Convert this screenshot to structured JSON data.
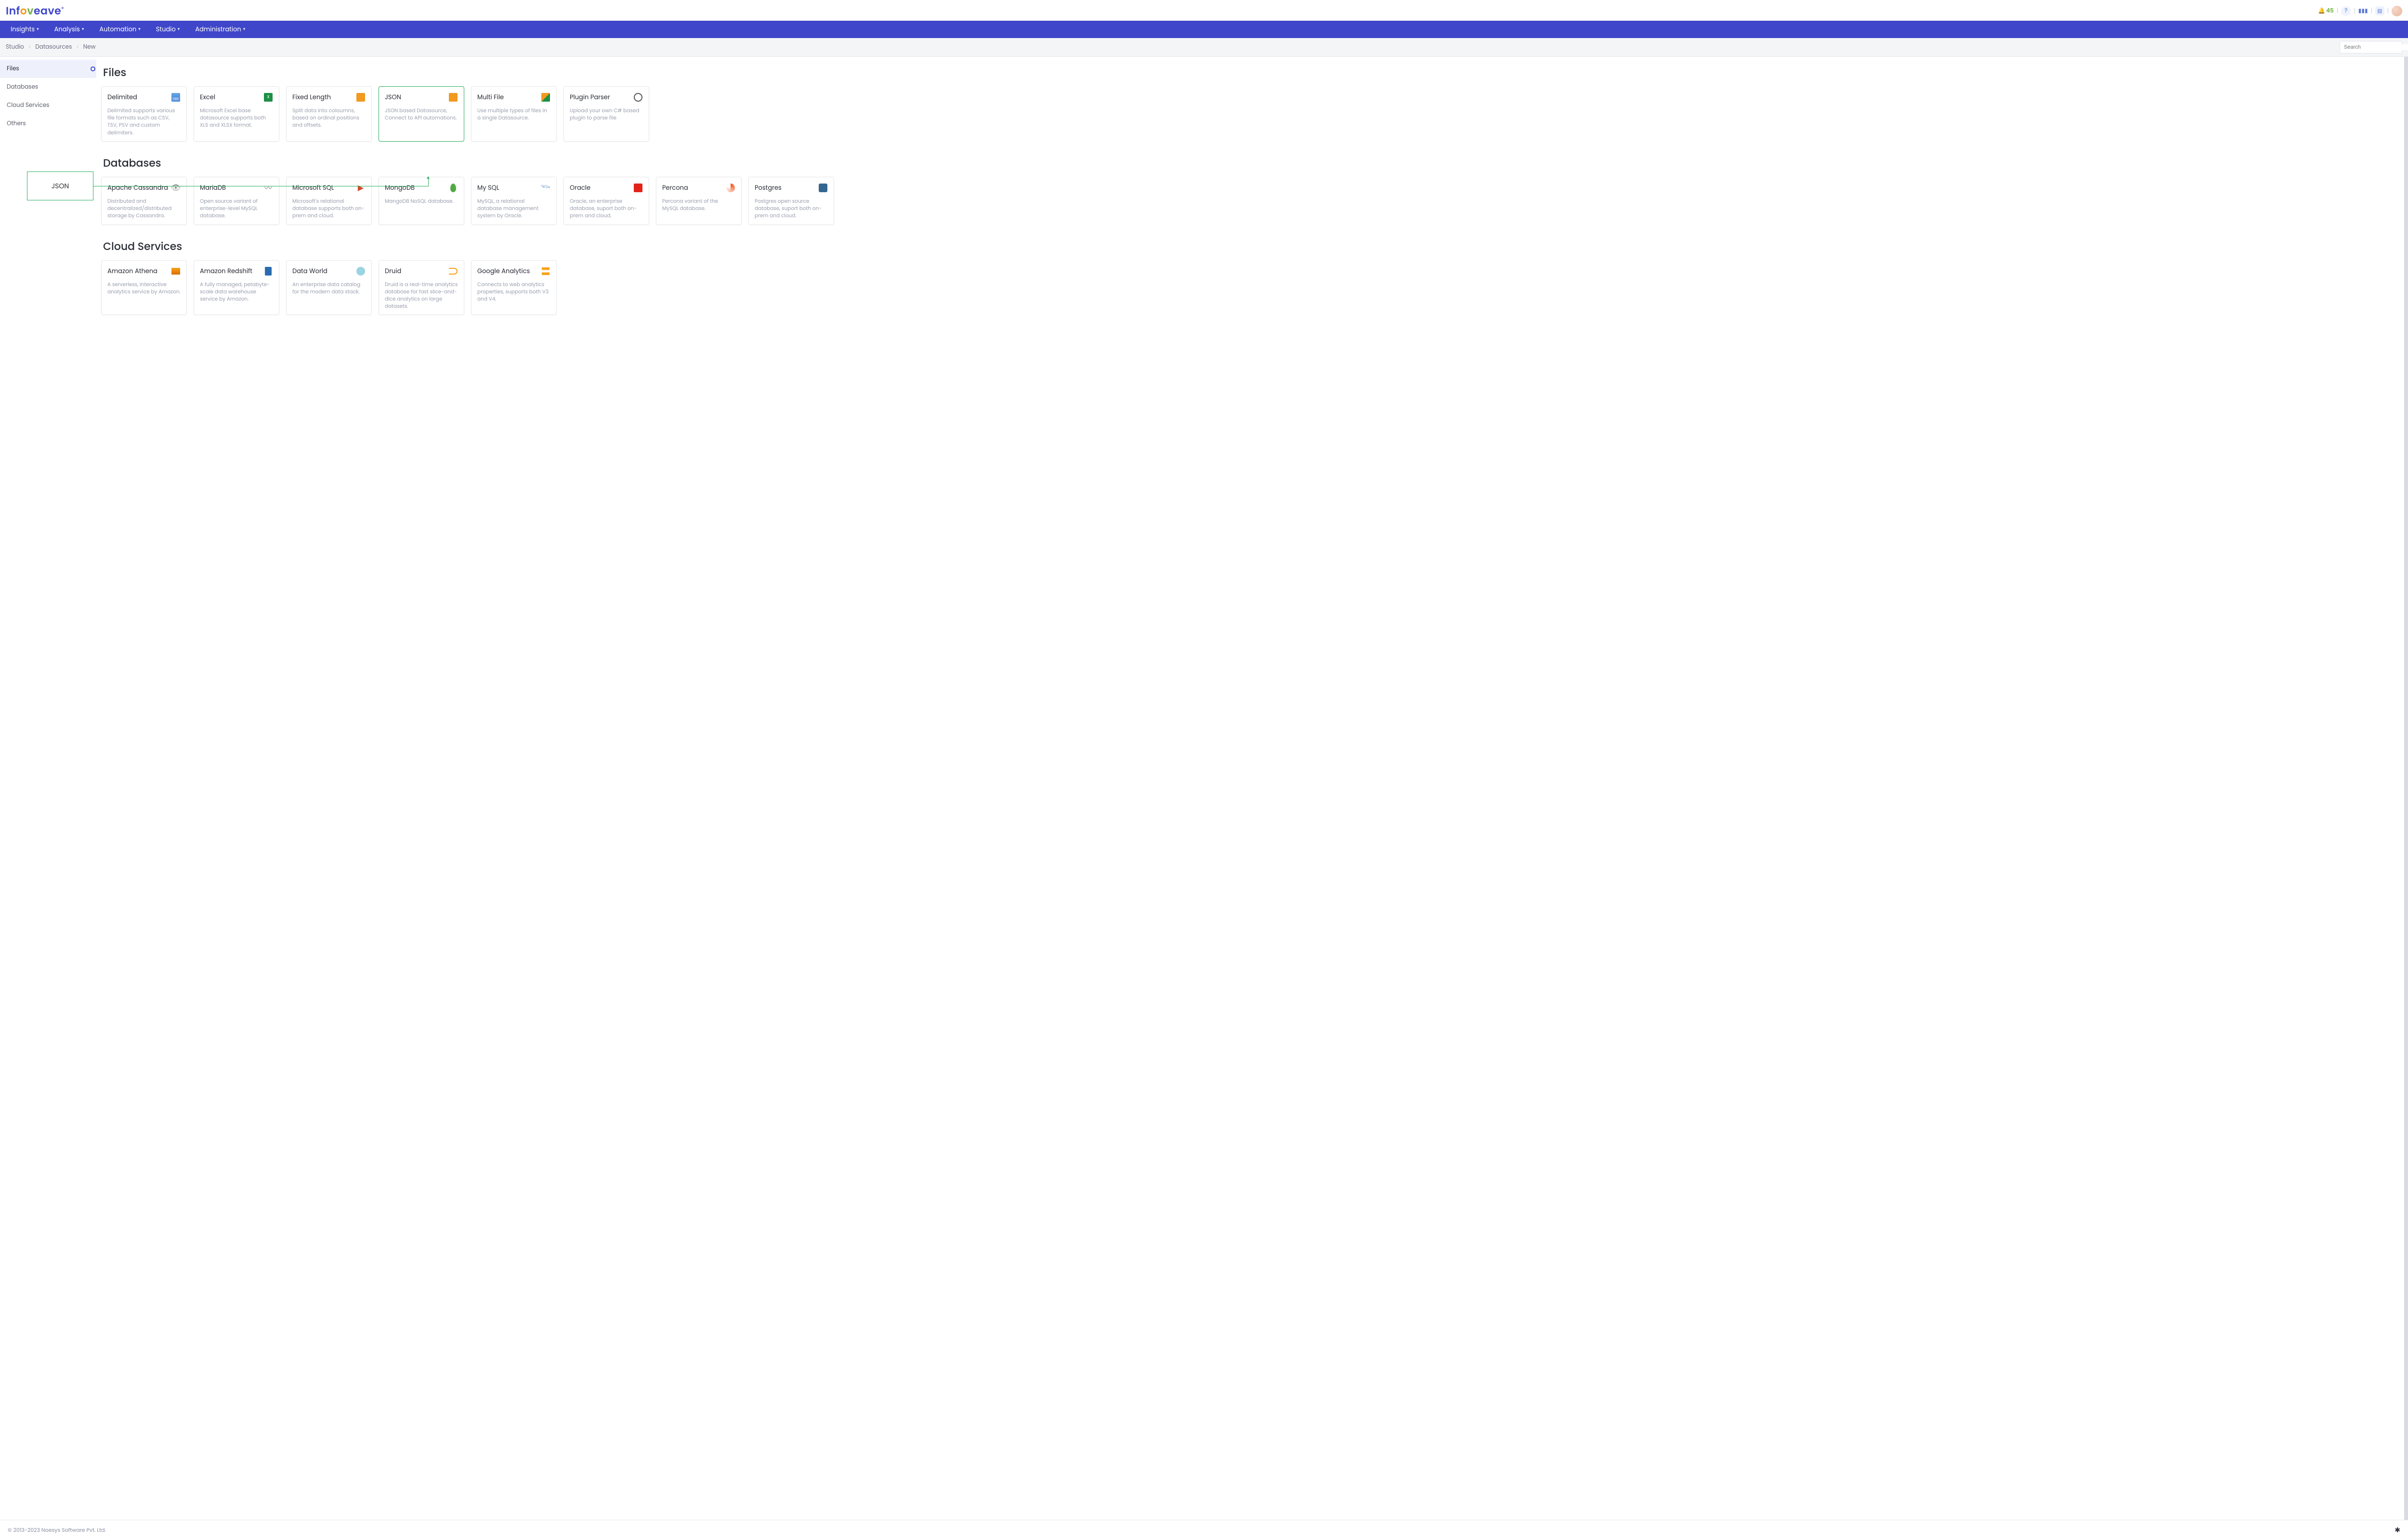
{
  "brand": {
    "part1": "Inf",
    "part2": "o",
    "part3": "v",
    "part4": "eave"
  },
  "notifications_count": "45",
  "nav": {
    "insights": "Insights",
    "analysis": "Analysis",
    "automation": "Automation",
    "studio": "Studio",
    "administration": "Administration"
  },
  "breadcrumbs": {
    "0": "Studio",
    "1": "Datasources",
    "2": "New"
  },
  "search_placeholder": "Search",
  "sidebar": {
    "files": "Files",
    "databases": "Databases",
    "cloud": "Cloud Services",
    "others": "Others"
  },
  "callout_label": "JSON",
  "sections": {
    "files": {
      "heading": "Files",
      "cards": {
        "delimited": {
          "title": "Delimited",
          "desc": "Delimited supports various file formats such as CSV, TSV, PSV and custom delimiters."
        },
        "excel": {
          "title": "Excel",
          "desc": "Microsoft Excel base datasource supports both XLS and XLSX format."
        },
        "fixed": {
          "title": "Fixed Length",
          "desc": "Split data into coloumns, based on ordinal positions and offsets."
        },
        "json": {
          "title": "JSON",
          "desc": "JSON based Datasource, Connect to API automations."
        },
        "multi": {
          "title": "Multi File",
          "desc": "Use multiple types of files in a single Datasource."
        },
        "plugin": {
          "title": "Plugin Parser",
          "desc": "Upload your own C# based plugin to parse file"
        }
      }
    },
    "databases": {
      "heading": "Databases",
      "cards": {
        "cassandra": {
          "title": "Apache Cassandra",
          "desc": "Distributed and decentralized/distributed storage by Cassandra."
        },
        "mariadb": {
          "title": "MariaDB",
          "desc": "Open source variant of enterprise-level MySQL database."
        },
        "mssql": {
          "title": "Microsoft SQL",
          "desc": "Microsoft's relational database supports both on-prem and cloud."
        },
        "mongo": {
          "title": "MongoDB",
          "desc": "MangoDB NoSQL database."
        },
        "mysql": {
          "title": "My SQL",
          "desc": "MySQL, a relational database management system by Oracle."
        },
        "oracle": {
          "title": "Oracle",
          "desc": "Oracle, an enterprise database, suport both on-prem and cloud."
        },
        "percona": {
          "title": "Percona",
          "desc": "Percona variant of the MySQL database."
        },
        "postgres": {
          "title": "Postgres",
          "desc": "Postgres open source database, suport both on-prem and cloud."
        }
      }
    },
    "cloud": {
      "heading": "Cloud Services",
      "cards": {
        "athena": {
          "title": "Amazon Athena",
          "desc": "A serverless, interactive analytics service by Amazon."
        },
        "redshift": {
          "title": "Amazon Redshift",
          "desc": "A fully managed, petabyte-scale data warehouse service by Amazon."
        },
        "dataworld": {
          "title": "Data World",
          "desc": "An enterprise data catalog for the modern data stack."
        },
        "druid": {
          "title": "Druid",
          "desc": "Druid is a real-time analytics database for fast slice-and-dice analytics on large datasets."
        },
        "ga": {
          "title": "Google Analytics",
          "desc": "Connects to web analytics properties, supports both V3 and V4."
        }
      }
    }
  },
  "footer_text": "© 2013-2023 Noesys Software Pvt. Ltd."
}
